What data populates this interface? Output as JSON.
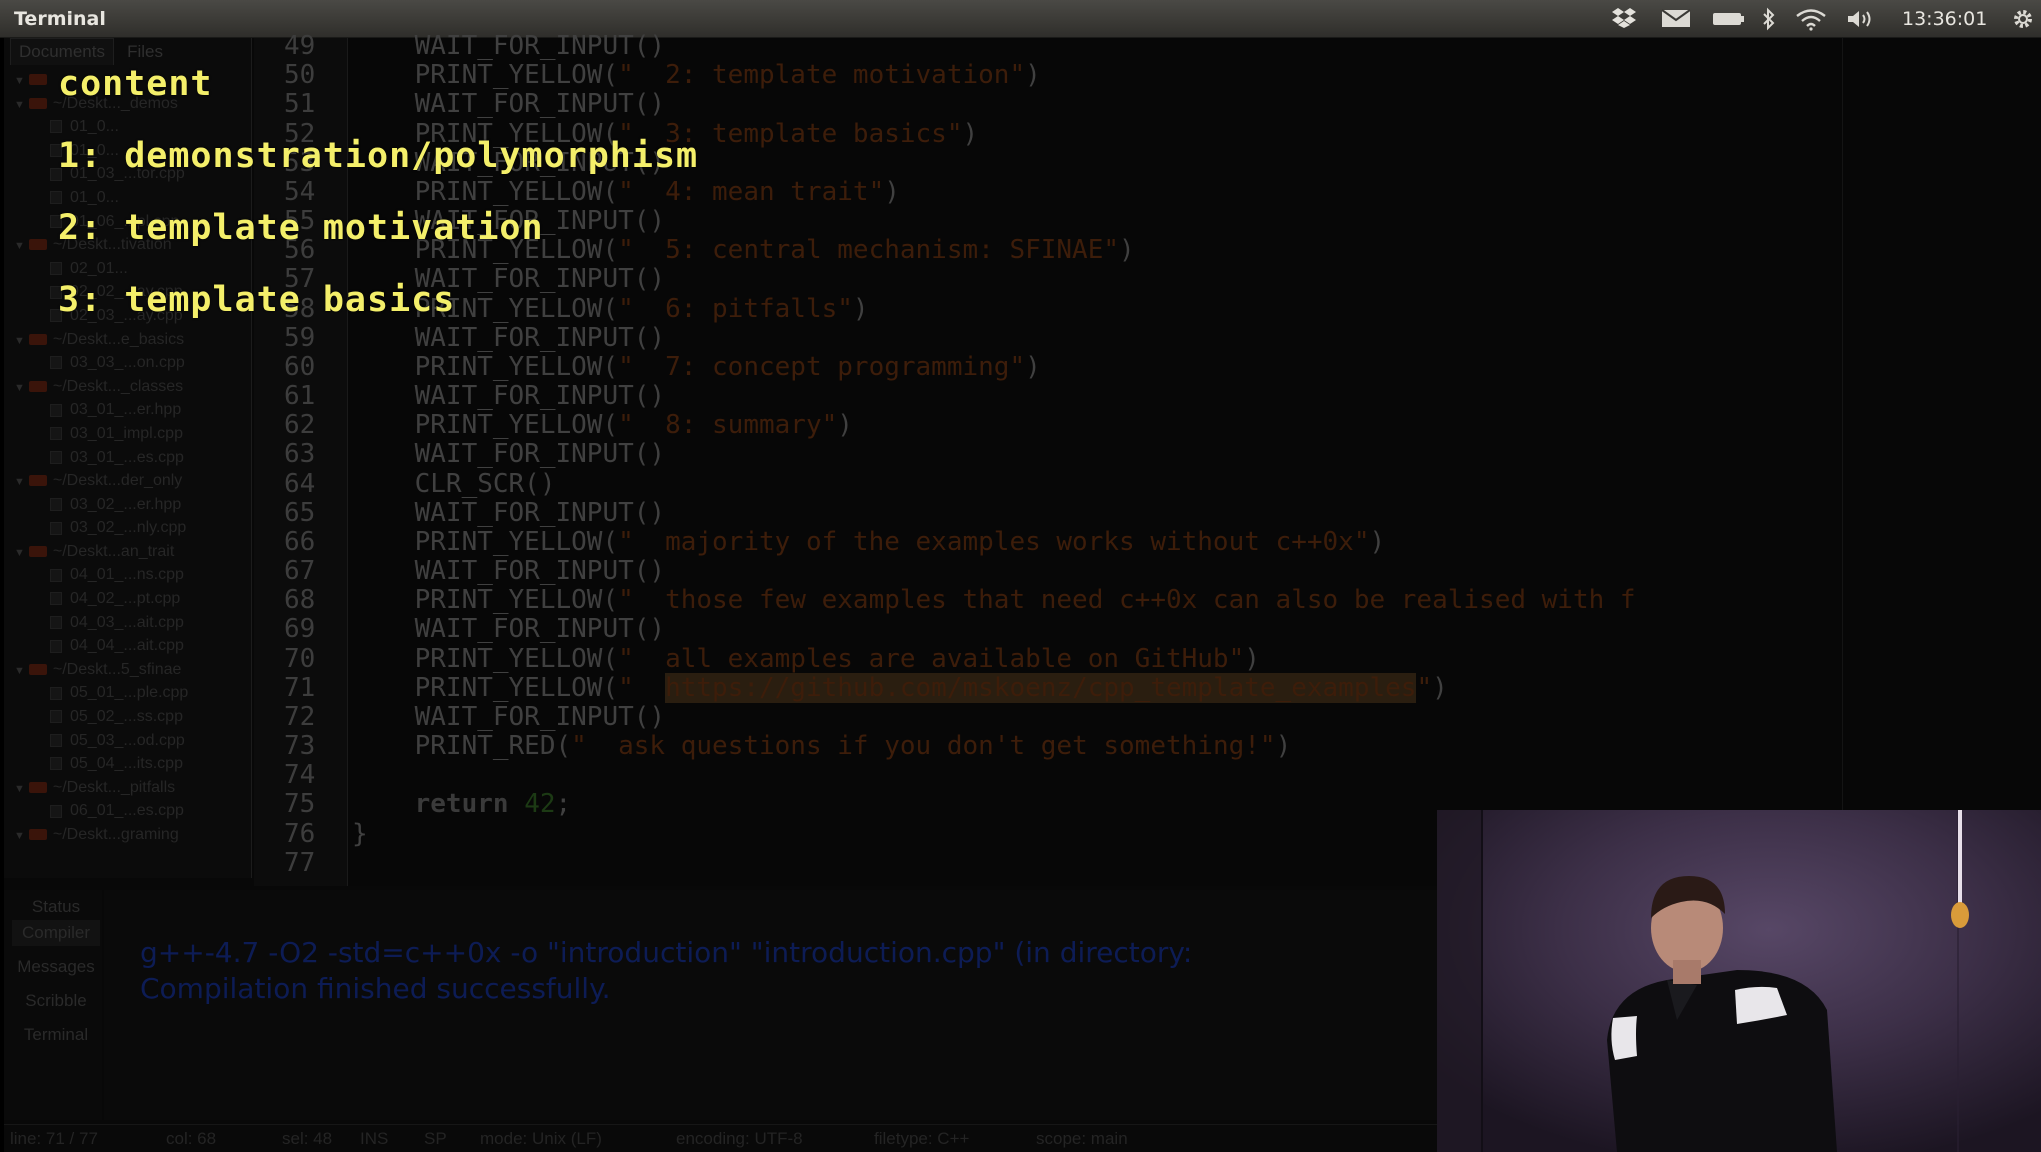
{
  "top_panel": {
    "title": "Terminal",
    "clock": "13:36:01",
    "icons": [
      "dropbox-icon",
      "mail-icon",
      "battery-icon",
      "bluetooth-icon",
      "wifi-icon",
      "volume-icon",
      "gear-icon"
    ]
  },
  "sidebar": {
    "tabs": [
      "Documents",
      "Files"
    ],
    "items": [
      {
        "type": "folder",
        "label": ""
      },
      {
        "type": "folder",
        "label": "~/Deskt..._demos"
      },
      {
        "type": "file",
        "label": "01_0..."
      },
      {
        "type": "file",
        "label": "01_0..."
      },
      {
        "type": "file",
        "label": "01_03_...tor.cpp"
      },
      {
        "type": "file",
        "label": "01_0..."
      },
      {
        "type": "file",
        "label": "01_06_...pl.cpp"
      },
      {
        "type": "folder",
        "label": "~/Deskt...tivation"
      },
      {
        "type": "file",
        "label": "02_01..."
      },
      {
        "type": "file",
        "label": "02_02_...ay.cpp"
      },
      {
        "type": "file",
        "label": "02_03_...ay.cpp"
      },
      {
        "type": "folder",
        "label": "~/Deskt...e_basics"
      },
      {
        "type": "file",
        "label": "03_03_...on.cpp"
      },
      {
        "type": "folder",
        "label": "~/Deskt..._classes"
      },
      {
        "type": "file",
        "label": "03_01_...er.hpp"
      },
      {
        "type": "file",
        "label": "03_01_impl.cpp"
      },
      {
        "type": "file",
        "label": "03_01_...es.cpp"
      },
      {
        "type": "folder",
        "label": "~/Deskt...der_only"
      },
      {
        "type": "file",
        "label": "03_02_...er.hpp"
      },
      {
        "type": "file",
        "label": "03_02_...nly.cpp"
      },
      {
        "type": "folder",
        "label": "~/Deskt...an_trait"
      },
      {
        "type": "file",
        "label": "04_01_...ns.cpp"
      },
      {
        "type": "file",
        "label": "04_02_...pt.cpp"
      },
      {
        "type": "file",
        "label": "04_03_...ait.cpp"
      },
      {
        "type": "file",
        "label": "04_04_...ait.cpp"
      },
      {
        "type": "folder",
        "label": "~/Deskt...5_sfinae"
      },
      {
        "type": "file",
        "label": "05_01_...ple.cpp"
      },
      {
        "type": "file",
        "label": "05_02_...ss.cpp"
      },
      {
        "type": "file",
        "label": "05_03_...od.cpp"
      },
      {
        "type": "file",
        "label": "05_04_...its.cpp"
      },
      {
        "type": "folder",
        "label": "~/Deskt..._pitfalls"
      },
      {
        "type": "file",
        "label": "06_01_...es.cpp"
      },
      {
        "type": "folder",
        "label": "~/Deskt...graming"
      }
    ]
  },
  "editor": {
    "lines": [
      {
        "n": "49",
        "parts": [
          [
            "fn",
            "    WAIT_FOR_INPUT()"
          ]
        ]
      },
      {
        "n": "50",
        "parts": [
          [
            "fn",
            "    PRINT_YELLOW("
          ],
          [
            "str",
            "\"  2: template motivation\""
          ],
          [
            "fn",
            ")"
          ]
        ]
      },
      {
        "n": "51",
        "parts": [
          [
            "fn",
            "    WAIT_FOR_INPUT()"
          ]
        ]
      },
      {
        "n": "52",
        "parts": [
          [
            "fn",
            "    PRINT_YELLOW("
          ],
          [
            "str",
            "\"  3: template basics\""
          ],
          [
            "fn",
            ")"
          ]
        ]
      },
      {
        "n": "53",
        "parts": [
          [
            "fn",
            "    WAIT_FOR_INPUT()"
          ]
        ]
      },
      {
        "n": "54",
        "parts": [
          [
            "fn",
            "    PRINT_YELLOW("
          ],
          [
            "str",
            "\"  4: mean trait\""
          ],
          [
            "fn",
            ")"
          ]
        ]
      },
      {
        "n": "55",
        "parts": [
          [
            "fn",
            "    WAIT_FOR_INPUT()"
          ]
        ]
      },
      {
        "n": "56",
        "parts": [
          [
            "fn",
            "    PRINT_YELLOW("
          ],
          [
            "str",
            "\"  5: central mechanism: SFINAE\""
          ],
          [
            "fn",
            ")"
          ]
        ]
      },
      {
        "n": "57",
        "parts": [
          [
            "fn",
            "    WAIT_FOR_INPUT()"
          ]
        ]
      },
      {
        "n": "58",
        "parts": [
          [
            "fn",
            "    PRINT_YELLOW("
          ],
          [
            "str",
            "\"  6: pitfalls\""
          ],
          [
            "fn",
            ")"
          ]
        ]
      },
      {
        "n": "59",
        "parts": [
          [
            "fn",
            "    WAIT_FOR_INPUT()"
          ]
        ]
      },
      {
        "n": "60",
        "parts": [
          [
            "fn",
            "    PRINT_YELLOW("
          ],
          [
            "str",
            "\"  7: concept programming\""
          ],
          [
            "fn",
            ")"
          ]
        ]
      },
      {
        "n": "61",
        "parts": [
          [
            "fn",
            "    WAIT_FOR_INPUT()"
          ]
        ]
      },
      {
        "n": "62",
        "parts": [
          [
            "fn",
            "    PRINT_YELLOW("
          ],
          [
            "str",
            "\"  8: summary\""
          ],
          [
            "fn",
            ")"
          ]
        ]
      },
      {
        "n": "63",
        "parts": [
          [
            "fn",
            "    WAIT_FOR_INPUT()"
          ]
        ]
      },
      {
        "n": "64",
        "parts": [
          [
            "fn",
            "    CLR_SCR()"
          ]
        ]
      },
      {
        "n": "65",
        "parts": [
          [
            "fn",
            "    WAIT_FOR_INPUT()"
          ]
        ]
      },
      {
        "n": "66",
        "parts": [
          [
            "fn",
            "    PRINT_YELLOW("
          ],
          [
            "str",
            "\"  majority of the examples works without c++0x\""
          ],
          [
            "fn",
            ")"
          ]
        ]
      },
      {
        "n": "67",
        "parts": [
          [
            "fn",
            "    WAIT_FOR_INPUT()"
          ]
        ]
      },
      {
        "n": "68",
        "parts": [
          [
            "fn",
            "    PRINT_YELLOW("
          ],
          [
            "str",
            "\"  those few examples that need c++0x can also be realised with f"
          ]
        ]
      },
      {
        "n": "69",
        "parts": [
          [
            "fn",
            "    WAIT_FOR_INPUT()"
          ]
        ]
      },
      {
        "n": "70",
        "parts": [
          [
            "fn",
            "    PRINT_YELLOW("
          ],
          [
            "str",
            "\"  all examples are available on GitHub\""
          ],
          [
            "fn",
            ")"
          ]
        ]
      },
      {
        "n": "71",
        "parts": [
          [
            "fn",
            "    PRINT_YELLOW("
          ],
          [
            "str",
            "\"  "
          ],
          [
            "link",
            "https://github.com/mskoenz/cpp_template_examples"
          ],
          [
            "str",
            "\""
          ],
          [
            "fn",
            ")"
          ]
        ]
      },
      {
        "n": "72",
        "parts": [
          [
            "fn",
            "    WAIT_FOR_INPUT()"
          ]
        ]
      },
      {
        "n": "73",
        "parts": [
          [
            "fn",
            "    PRINT_RED("
          ],
          [
            "str",
            "\"  ask questions if you don't get something!\""
          ],
          [
            "fn",
            ")"
          ]
        ]
      },
      {
        "n": "74",
        "parts": [
          [
            "fn",
            ""
          ]
        ]
      },
      {
        "n": "75",
        "parts": [
          [
            "kw",
            "    return"
          ],
          [
            "fn",
            " "
          ],
          [
            "num",
            "42"
          ],
          [
            "fn",
            ";"
          ]
        ]
      },
      {
        "n": "76",
        "parts": [
          [
            "fn",
            "}"
          ]
        ]
      },
      {
        "n": "77",
        "parts": [
          [
            "fn",
            ""
          ]
        ]
      }
    ]
  },
  "bottom_panel": {
    "tabs": [
      "Status",
      "Compiler",
      "Messages",
      "Scribble",
      "Terminal"
    ],
    "messages": [
      "g++-4.7 -O2 -std=c++0x -o \"introduction\" \"introduction.cpp\" (in directory:",
      "Compilation finished successfully."
    ]
  },
  "status_bar": {
    "line": "line: 71 / 77",
    "col": "col: 68",
    "sel": "sel: 48",
    "ins": "INS",
    "sp": "SP",
    "mode": "mode: Unix (LF)",
    "encoding": "encoding: UTF-8",
    "filetype": "filetype: C++",
    "scope": "scope: main"
  },
  "overlay": {
    "lines": [
      "content",
      "1: demonstration/polymorphism",
      "2: template motivation",
      "3: template basics"
    ]
  },
  "colors": {
    "overlay_text": "#f4ef6a",
    "message_text": "#0d1c55",
    "panel_bg": "#3a3935"
  }
}
